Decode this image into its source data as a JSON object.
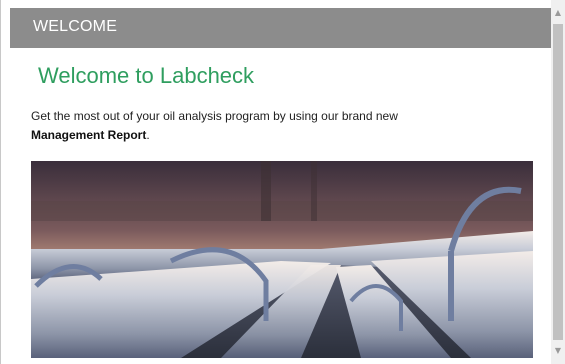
{
  "header": {
    "title": "WELCOME"
  },
  "content": {
    "heading": "Welcome to Labcheck",
    "intro_text": "Get the most out of your oil analysis program by using our brand new ",
    "intro_bold": "Management Report",
    "intro_end": "."
  },
  "hero_image": {
    "subject": "pipelines"
  },
  "colors": {
    "header_bg": "#8c8c8c",
    "heading": "#2f9e5f"
  },
  "scrollbar": {
    "up_icon": "▲",
    "down_icon": "▼"
  }
}
